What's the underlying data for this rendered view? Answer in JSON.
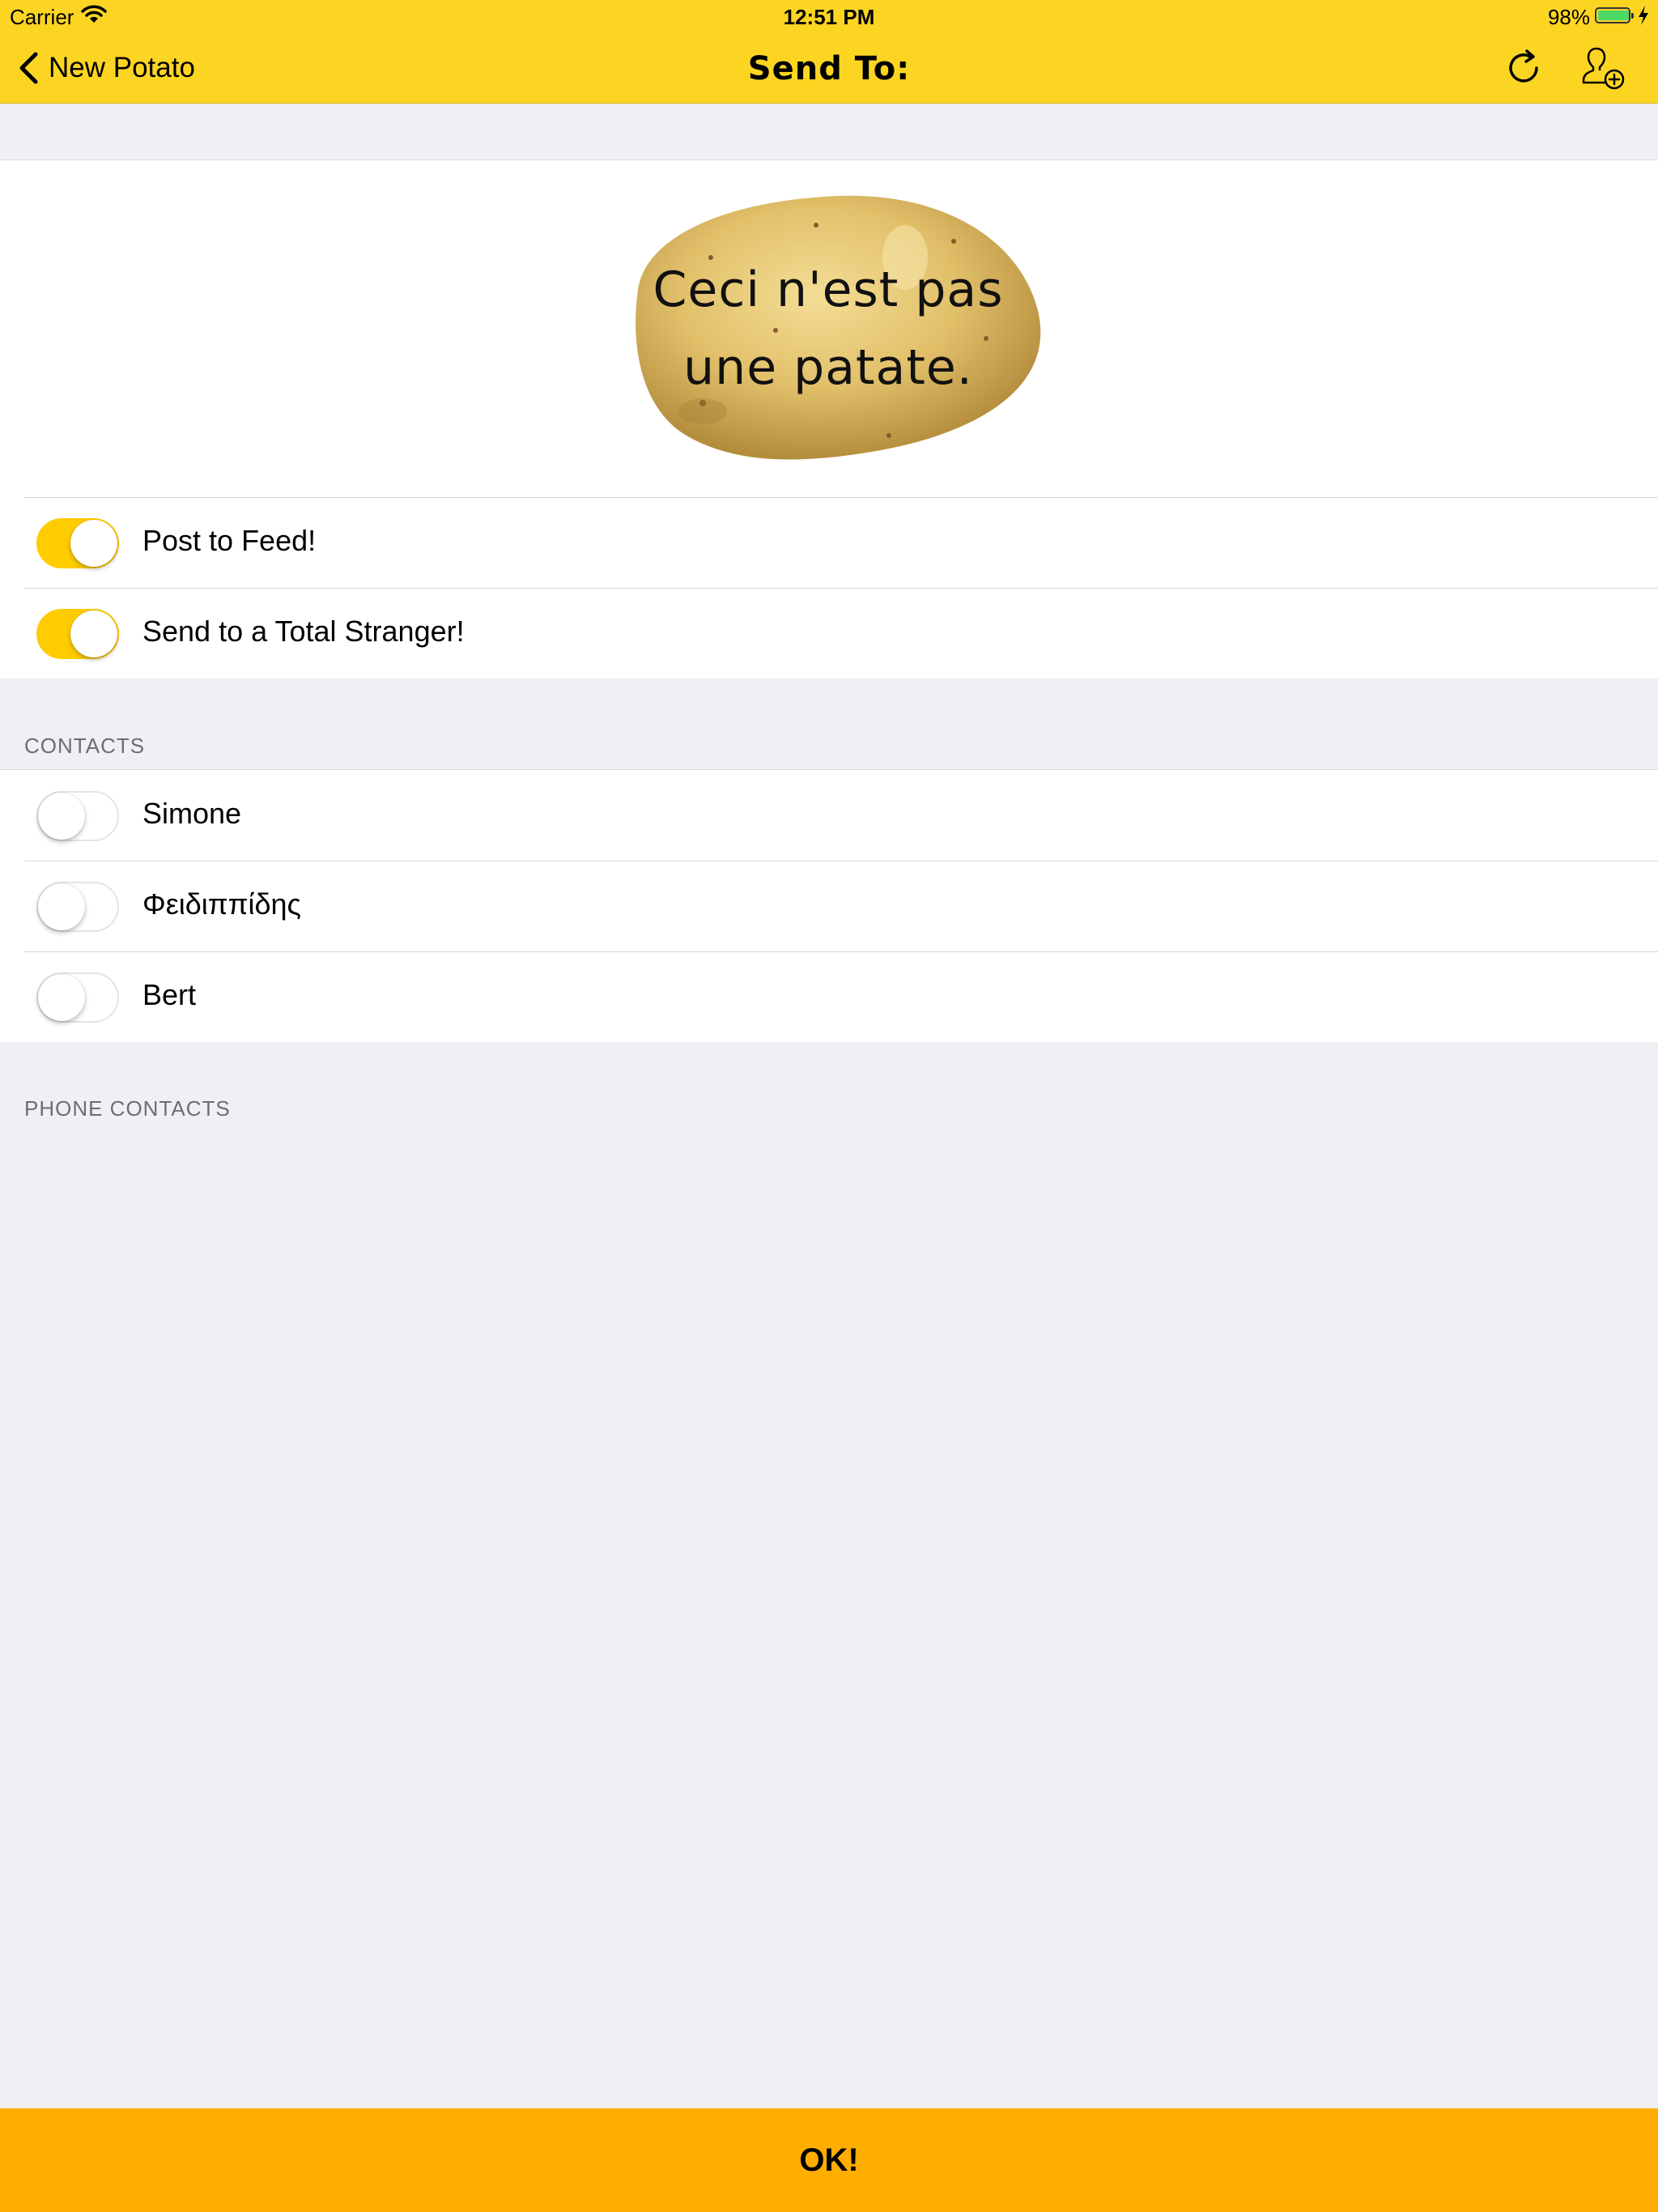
{
  "status_bar": {
    "carrier": "Carrier",
    "time": "12:51 PM",
    "battery_percent": "98%",
    "battery_level": 0.98,
    "wifi_icon": "wifi-icon",
    "battery_color": "#4cd964"
  },
  "nav": {
    "back_label": "New Potato",
    "title": "Send To:",
    "right_icons": [
      "refresh-icon",
      "add-contact-icon"
    ]
  },
  "potato": {
    "line1": "Ceci n'est pas",
    "line2": "une patate."
  },
  "options": [
    {
      "label": "Post to Feed!",
      "on": true
    },
    {
      "label": "Send to a Total Stranger!",
      "on": true
    }
  ],
  "contacts": {
    "header": "CONTACTS",
    "items": [
      {
        "name": "Simone",
        "on": false
      },
      {
        "name": "Φειδιππίδης",
        "on": false
      },
      {
        "name": "Bert",
        "on": false
      }
    ]
  },
  "phone_contacts": {
    "header": "PHONE CONTACTS"
  },
  "ok_button": {
    "label": "OK!"
  },
  "colors": {
    "bar_yellow": "#fcd523",
    "toggle_on": "#ffcc00",
    "ok_orange": "#ffae00",
    "background": "#efeff4"
  }
}
